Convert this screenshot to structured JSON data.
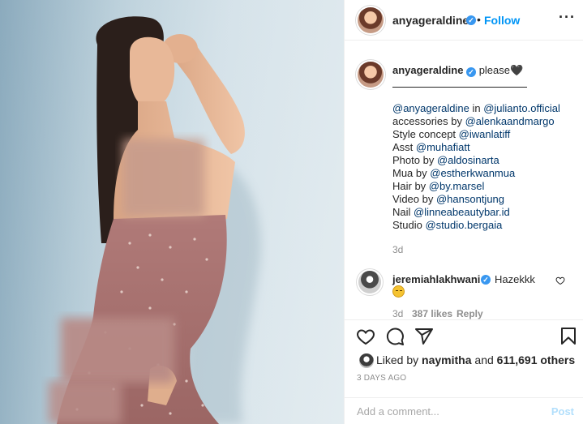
{
  "post": {
    "username": "anyageraldine",
    "verified_mark": "✓",
    "dot": "•",
    "follow_label": "Follow",
    "more_label": "···",
    "avatar_icon": "profile-avatar",
    "photo": {
      "description_icon": "post-photo",
      "blur_regions": 3
    }
  },
  "caption": {
    "username": "anyageraldine",
    "text": "please🖤",
    "credits": [
      {
        "parts": [
          {
            "t": "@anyageraldine",
            "m": true
          },
          {
            "t": " in ",
            "m": false
          },
          {
            "t": "@julianto.official",
            "m": true
          }
        ]
      },
      {
        "parts": [
          {
            "t": "accessories by ",
            "m": false
          },
          {
            "t": "@alenkaandmargo",
            "m": true
          }
        ]
      },
      {
        "parts": [
          {
            "t": "Style concept ",
            "m": false
          },
          {
            "t": "@iwanlatiff",
            "m": true
          }
        ]
      },
      {
        "parts": [
          {
            "t": "Asst ",
            "m": false
          },
          {
            "t": "@muhafiatt",
            "m": true
          }
        ]
      },
      {
        "parts": [
          {
            "t": "Photo by ",
            "m": false
          },
          {
            "t": "@aldosinarta",
            "m": true
          }
        ]
      },
      {
        "parts": [
          {
            "t": "Mua by ",
            "m": false
          },
          {
            "t": "@estherkwanmua",
            "m": true
          }
        ]
      },
      {
        "parts": [
          {
            "t": "Hair by ",
            "m": false
          },
          {
            "t": "@by.marsel",
            "m": true
          }
        ]
      },
      {
        "parts": [
          {
            "t": "Video by ",
            "m": false
          },
          {
            "t": "@hansontjung",
            "m": true
          }
        ]
      },
      {
        "parts": [
          {
            "t": "Nail ",
            "m": false
          },
          {
            "t": "@linneabeautybar.id",
            "m": true
          }
        ]
      },
      {
        "parts": [
          {
            "t": "Studio ",
            "m": false
          },
          {
            "t": "@studio.bergaia",
            "m": true
          }
        ]
      }
    ],
    "age": "3d"
  },
  "comment": {
    "username": "jeremiahlakhwani",
    "text": "Hazekkk",
    "age": "3d",
    "likes": "387 likes",
    "reply_label": "Reply"
  },
  "actions": {
    "like_icon": "heart-icon",
    "comment_icon": "comment-icon",
    "share_icon": "share-icon",
    "save_icon": "bookmark-icon"
  },
  "likes": {
    "prefix": "Liked by ",
    "user": "naymitha",
    "middle": " and ",
    "count": "611,691 others"
  },
  "date": "3 DAYS AGO",
  "add_comment": {
    "placeholder": "Add a comment...",
    "post_label": "Post"
  },
  "colors": {
    "link": "#00376b",
    "follow": "#0095f6",
    "verified": "#3897f0",
    "muted": "#8e8e8e",
    "post_disabled": "#b2dffc"
  }
}
